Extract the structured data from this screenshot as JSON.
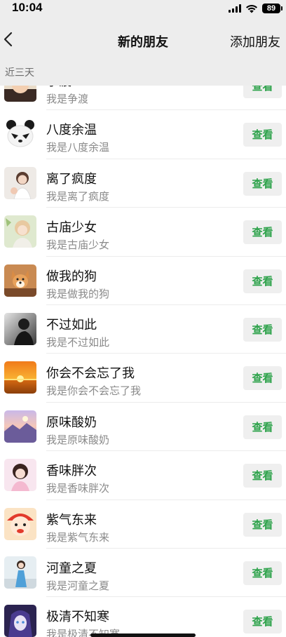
{
  "status_bar": {
    "time": "10:04",
    "battery": "89"
  },
  "nav": {
    "title": "新的朋友",
    "action": "添加朋友"
  },
  "section": {
    "title": "近三天"
  },
  "view_label": "查看",
  "friends": [
    {
      "name": "争渡",
      "desc": "我是争渡",
      "avatar_icon": "baby-avatar-icon"
    },
    {
      "name": "八度余温",
      "desc": "我是八度余温",
      "avatar_icon": "panda-avatar-icon"
    },
    {
      "name": "离了疯度",
      "desc": "我是离了疯度",
      "avatar_icon": "girl-avatar-icon"
    },
    {
      "name": "古庙少女",
      "desc": "我是古庙少女",
      "avatar_icon": "blonde-girl-avatar-icon"
    },
    {
      "name": "做我的狗",
      "desc": "我是做我的狗",
      "avatar_icon": "dog-avatar-icon"
    },
    {
      "name": "不过如此",
      "desc": "我是不过如此",
      "avatar_icon": "dark-man-avatar-icon"
    },
    {
      "name": "你会不会忘了我",
      "desc": "我是你会不会忘了我",
      "avatar_icon": "sunset-avatar-icon"
    },
    {
      "name": "原味酸奶",
      "desc": "我是原味酸奶",
      "avatar_icon": "landscape-avatar-icon"
    },
    {
      "name": "香味胖次",
      "desc": "我是香味胖次",
      "avatar_icon": "pink-girl-avatar-icon"
    },
    {
      "name": "紫气东来",
      "desc": "我是紫气东来",
      "avatar_icon": "cartoon-avatar-icon"
    },
    {
      "name": "河童之夏",
      "desc": "我是河童之夏",
      "avatar_icon": "blue-dress-avatar-icon"
    },
    {
      "name": "极清不知寒",
      "desc": "我是极清不知寒",
      "avatar_icon": "anime-avatar-icon"
    }
  ],
  "colors": {
    "accent_green": "#2fa34c",
    "header_bg": "#ededed",
    "subtitle_gray": "#8a8a8a"
  }
}
